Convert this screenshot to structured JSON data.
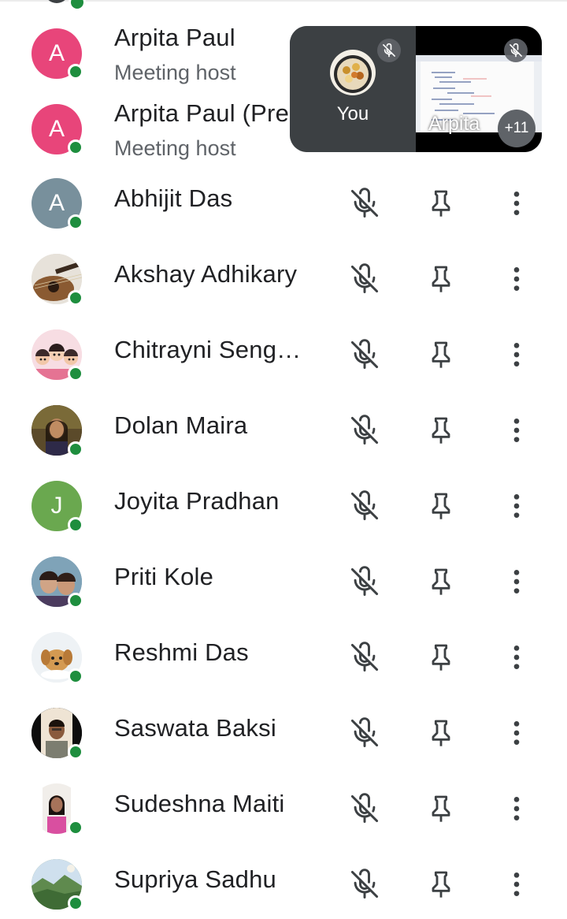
{
  "video_panel": {
    "self_label": "You",
    "other_label": "Arpita",
    "more_count": "+11"
  },
  "participants": [
    {
      "name": "Arpita Paul",
      "subtitle": "Meeting host",
      "initial": "A",
      "avatar_color": "#e8457a"
    },
    {
      "name": "Arpita Paul (Presentation)",
      "subtitle": "Meeting host",
      "initial": "A",
      "avatar_color": "#e8457a"
    },
    {
      "name": "Abhijit Das",
      "initial": "A",
      "avatar_color": "#78909c"
    },
    {
      "name": "Akshay Adhikary",
      "avatar_icon": "guitar-photo-icon"
    },
    {
      "name": "Chitrayni Seng…",
      "avatar_icon": "cartoon-group-photo-icon"
    },
    {
      "name": "Dolan Maira",
      "avatar_icon": "portrait-photo-icon"
    },
    {
      "name": "Joyita Pradhan",
      "initial": "J",
      "avatar_color": "#6aa84f"
    },
    {
      "name": "Priti Kole",
      "avatar_icon": "group-selfie-photo-icon"
    },
    {
      "name": "Reshmi Das",
      "avatar_icon": "puppy-photo-icon"
    },
    {
      "name": "Saswata Baksi",
      "avatar_icon": "portrait-photo-icon"
    },
    {
      "name": "Sudeshna Maiti",
      "avatar_icon": "portrait-photo-icon"
    },
    {
      "name": "Supriya Sadhu",
      "avatar_icon": "landscape-photo-icon"
    }
  ],
  "colors": {
    "presence": "#1e8e3e",
    "text_primary": "#202124",
    "text_secondary": "#5f6368",
    "panel_bg": "#3c4043"
  }
}
